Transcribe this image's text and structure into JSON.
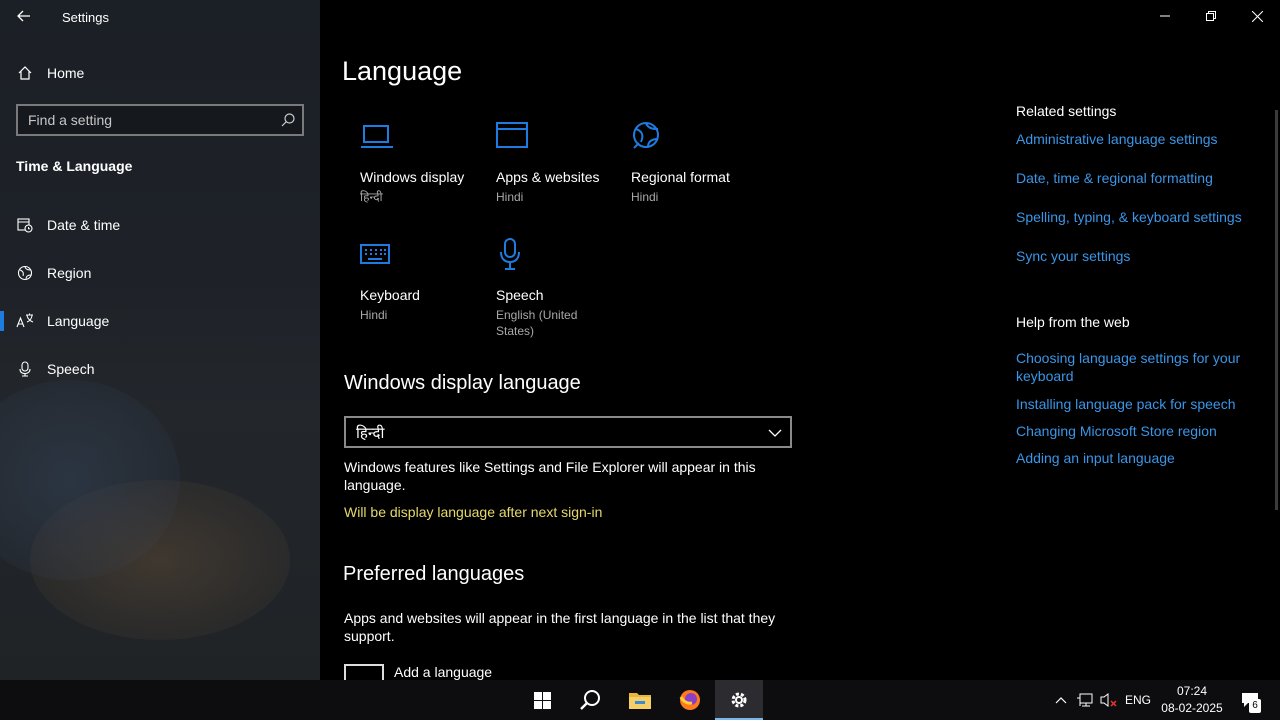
{
  "app": {
    "title": "Settings"
  },
  "sidebar": {
    "home_label": "Home",
    "search_placeholder": "Find a setting",
    "section_title": "Time & Language",
    "items": [
      {
        "label": "Date & time",
        "icon": "calendar-clock-icon"
      },
      {
        "label": "Region",
        "icon": "globe-region-icon"
      },
      {
        "label": "Language",
        "icon": "language-icon",
        "active": true
      },
      {
        "label": "Speech",
        "icon": "microphone-icon"
      }
    ]
  },
  "main": {
    "title": "Language",
    "tiles": [
      {
        "name": "Windows display",
        "sub": "हिन्दी",
        "icon": "laptop-icon"
      },
      {
        "name": "Apps & websites",
        "sub": "Hindi",
        "icon": "window-icon"
      },
      {
        "name": "Regional format",
        "sub": "Hindi",
        "icon": "globe-icon"
      },
      {
        "name": "Keyboard",
        "sub": "Hindi",
        "icon": "keyboard-icon"
      },
      {
        "name": "Speech",
        "sub": "English (United States)",
        "icon": "microphone-icon"
      }
    ],
    "display_language": {
      "heading": "Windows display language",
      "selected": "हिन्दी",
      "description": "Windows features like Settings and File Explorer will appear in this language.",
      "warning": "Will be display language after next sign-in"
    },
    "preferred": {
      "heading": "Preferred languages",
      "description": "Apps and websites will appear in the first language in the list that they support.",
      "add_label": "Add a language"
    }
  },
  "related": {
    "heading": "Related settings",
    "links": [
      "Administrative language settings",
      "Date, time & regional formatting",
      "Spelling, typing, & keyboard settings",
      "Sync your settings"
    ]
  },
  "help": {
    "heading": "Help from the web",
    "links": [
      "Choosing language settings for your keyboard",
      "Installing language pack for speech",
      "Changing Microsoft Store region",
      "Adding an input language"
    ]
  },
  "taskbar": {
    "apps": [
      "start-icon",
      "search-icon",
      "file-explorer-icon",
      "firefox-icon",
      "settings-icon"
    ],
    "lang": "ENG",
    "time": "07:24",
    "date": "08-02-2025",
    "notifications": "6"
  },
  "colors": {
    "accent": "#1e7be0",
    "link": "#3a96e8",
    "warning": "#e5d96a"
  }
}
